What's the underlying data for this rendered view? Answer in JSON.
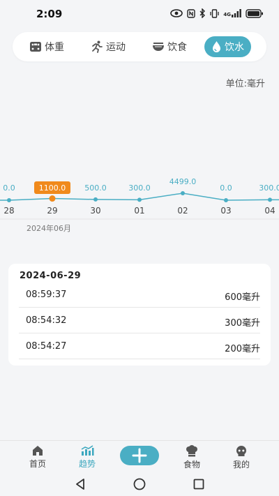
{
  "status_bar": {
    "time": "2:09",
    "network": "4G",
    "icons": [
      "eye-icon",
      "nfc-icon",
      "bluetooth-icon",
      "vibrate-icon",
      "signal-icon",
      "battery-icon"
    ]
  },
  "tabs": [
    {
      "label": "体重",
      "icon": "scale-icon",
      "active": false
    },
    {
      "label": "运动",
      "icon": "running-icon",
      "active": false
    },
    {
      "label": "饮食",
      "icon": "bowl-icon",
      "active": false
    },
    {
      "label": "饮水",
      "icon": "water-drop-icon",
      "active": true
    }
  ],
  "unit_label": "单位:毫升",
  "chart_data": {
    "type": "line",
    "categories": [
      "28",
      "29",
      "30",
      "01",
      "02",
      "03",
      "04"
    ],
    "values": [
      0.0,
      1100.0,
      500.0,
      300.0,
      4499.0,
      0.0,
      300.0
    ],
    "value_labels": [
      "0.0",
      "1100.0",
      "500.0",
      "300.0",
      "4499.0",
      "0.0",
      "300.0"
    ],
    "highlighted_index": 1,
    "x_group_label": "2024年06月",
    "line_color": "#4aaec4",
    "highlight_color": "#f08a1c"
  },
  "records": {
    "date": "2024-06-29",
    "items": [
      {
        "time": "08:59:37",
        "amount": "600毫升"
      },
      {
        "time": "08:54:32",
        "amount": "300毫升"
      },
      {
        "time": "08:54:27",
        "amount": "200毫升"
      }
    ]
  },
  "bottom_nav": {
    "items": [
      {
        "label": "首页",
        "icon": "home-icon",
        "active": false
      },
      {
        "label": "趋势",
        "icon": "trend-chart-icon",
        "active": true
      },
      {
        "label": "食物",
        "icon": "chef-hat-icon",
        "active": false
      },
      {
        "label": "我的",
        "icon": "profile-icon",
        "active": false
      }
    ],
    "add_icon": "plus-icon"
  },
  "colors": {
    "accent": "#4aaec4",
    "highlight": "#f08a1c",
    "background": "#f4f5f7"
  }
}
